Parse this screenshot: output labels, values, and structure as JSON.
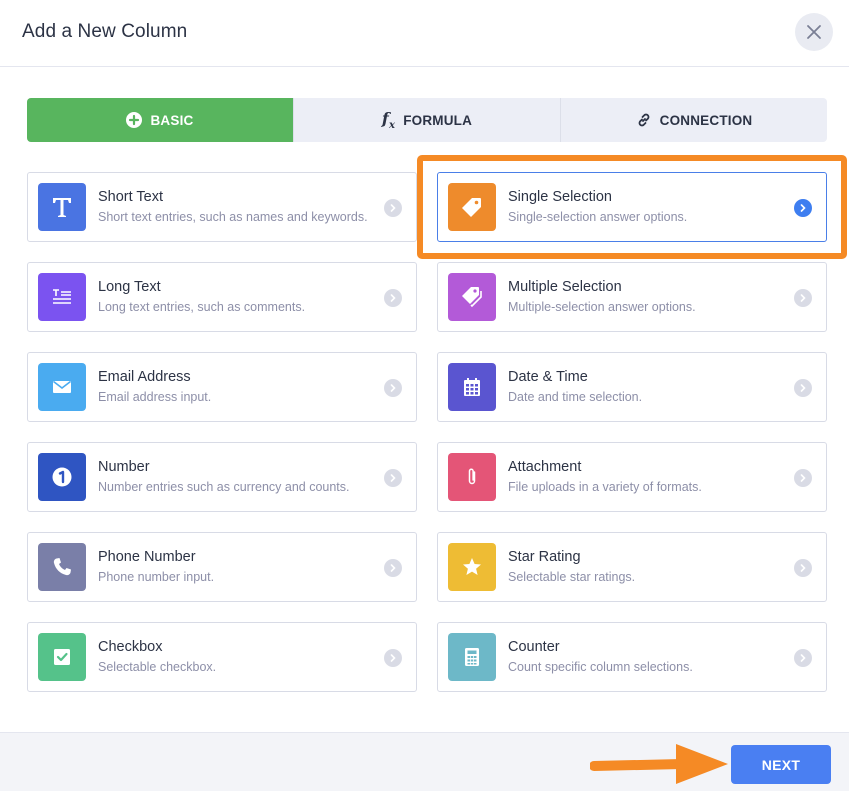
{
  "header": {
    "title": "Add a New Column"
  },
  "tabs": [
    {
      "label": "BASIC",
      "icon": "plus-circle-icon",
      "active": true
    },
    {
      "label": "FORMULA",
      "icon": "fx-icon",
      "active": false
    },
    {
      "label": "CONNECTION",
      "icon": "link-icon",
      "active": false
    }
  ],
  "fields": [
    {
      "name": "Short Text",
      "desc": "Short text entries, such as names and keywords.",
      "icon": "text-t-icon",
      "color": "#4a74e2",
      "selected": false
    },
    {
      "name": "Single Selection",
      "desc": "Single-selection answer options.",
      "icon": "tag-icon",
      "color": "#ee8b2c",
      "selected": true
    },
    {
      "name": "Long Text",
      "desc": "Long text entries, such as comments.",
      "icon": "long-text-icon",
      "color": "#7b53f0",
      "selected": false
    },
    {
      "name": "Multiple Selection",
      "desc": "Multiple-selection answer options.",
      "icon": "tags-icon",
      "color": "#b35ad8",
      "selected": false
    },
    {
      "name": "Email Address",
      "desc": "Email address input.",
      "icon": "envelope-icon",
      "color": "#4aabf0",
      "selected": false
    },
    {
      "name": "Date & Time",
      "desc": "Date and time selection.",
      "icon": "calendar-icon",
      "color": "#5a55d0",
      "selected": false
    },
    {
      "name": "Number",
      "desc": "Number entries such as currency and counts.",
      "icon": "number-one-icon",
      "color": "#2f55c2",
      "selected": false
    },
    {
      "name": "Attachment",
      "desc": "File uploads in a variety of formats.",
      "icon": "paperclip-icon",
      "color": "#e45577",
      "selected": false
    },
    {
      "name": "Phone Number",
      "desc": "Phone number input.",
      "icon": "phone-icon",
      "color": "#7a7fa8",
      "selected": false
    },
    {
      "name": "Star Rating",
      "desc": "Selectable star ratings.",
      "icon": "star-icon",
      "color": "#eebc34",
      "selected": false
    },
    {
      "name": "Checkbox",
      "desc": "Selectable checkbox.",
      "icon": "checkbox-icon",
      "color": "#55c28a",
      "selected": false
    },
    {
      "name": "Counter",
      "desc": "Count specific column selections.",
      "icon": "calculator-icon",
      "color": "#6db8c8",
      "selected": false
    }
  ],
  "footer": {
    "next_label": "NEXT"
  },
  "colors": {
    "accent": "#4a7ff2",
    "tab_active": "#58b55e",
    "highlight": "#f58a25"
  }
}
